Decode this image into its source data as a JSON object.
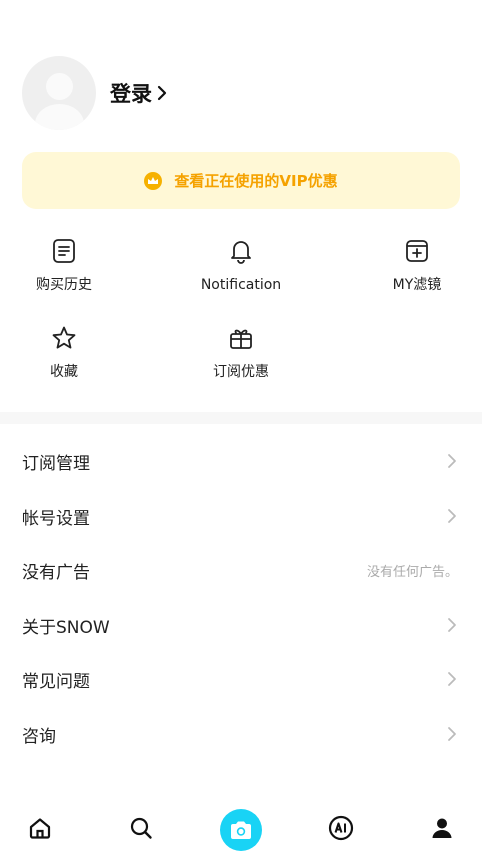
{
  "profile": {
    "login_label": "登录"
  },
  "vip_banner": {
    "text": "查看正在使用的VIP优惠"
  },
  "quick_actions": [
    {
      "label": "购买历史",
      "icon": "receipt-icon"
    },
    {
      "label": "Notification",
      "icon": "bell-icon"
    },
    {
      "label": "MY滤镜",
      "icon": "filter-add-icon"
    },
    {
      "label": "收藏",
      "icon": "star-icon"
    },
    {
      "label": "订阅优惠",
      "icon": "gift-icon"
    }
  ],
  "menu": [
    {
      "label": "订阅管理"
    },
    {
      "label": "帐号设置"
    },
    {
      "label": "没有广告",
      "note": "没有任何广告。"
    },
    {
      "label": "关于SNOW"
    },
    {
      "label": "常见问题"
    },
    {
      "label": "咨询"
    }
  ],
  "tabbar": {
    "items": [
      "home-icon",
      "search-icon",
      "camera-icon",
      "ai-icon",
      "profile-icon"
    ],
    "accent": "#19d3f5"
  },
  "colors": {
    "vip_text": "#f5a200",
    "vip_bg": "#fff8d6"
  }
}
